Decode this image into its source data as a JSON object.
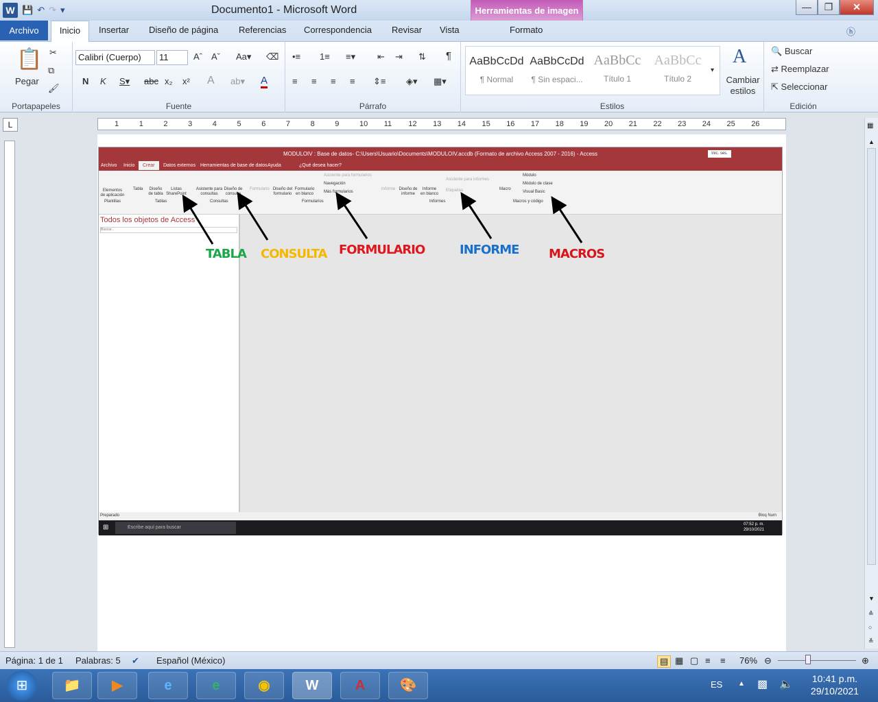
{
  "window": {
    "title": "Documento1 - Microsoft Word",
    "context_tab_header": "Herramientas de imagen",
    "minimize": "—",
    "restore": "❐",
    "close": "✕"
  },
  "tabs": {
    "file": "Archivo",
    "home": "Inicio",
    "insert": "Insertar",
    "layout": "Diseño de página",
    "references": "Referencias",
    "mailings": "Correspondencia",
    "review": "Revisar",
    "view": "Vista",
    "format": "Formato"
  },
  "ribbon": {
    "clipboard": {
      "label": "Portapapeles",
      "paste": "Pegar"
    },
    "font": {
      "label": "Fuente",
      "name": "Calibri (Cuerpo)",
      "size": "11"
    },
    "paragraph": {
      "label": "Párrafo"
    },
    "styles": {
      "label": "Estilos",
      "items": [
        {
          "preview": "AaBbCcDd",
          "name": "¶ Normal"
        },
        {
          "preview": "AaBbCcDd",
          "name": "¶ Sin espaci..."
        },
        {
          "preview": "AaBbCc",
          "name": "Título 1"
        },
        {
          "preview": "AaBbCc",
          "name": "Título 2"
        }
      ],
      "change_styles": "Cambiar estilos"
    },
    "editing": {
      "label": "Edición",
      "find": "Buscar",
      "replace": "Reemplazar",
      "select": "Seleccionar"
    }
  },
  "ruler": {
    "corner": "L",
    "ticks": [
      "1",
      "1",
      "2",
      "3",
      "4",
      "5",
      "6",
      "7",
      "8",
      "9",
      "10",
      "11",
      "12",
      "13",
      "14",
      "15",
      "16",
      "17",
      "18",
      "19",
      "20",
      "21",
      "22",
      "23",
      "24",
      "25",
      "26"
    ]
  },
  "embedded": {
    "title": "MODULOIV : Base de datos- C:\\Users\\Usuario\\Documents\\MODULOIV.accdb (Formato de archivo Access 2007 - 2016) - Access",
    "signin": "Inic. ses.",
    "tabs": [
      "Archivo",
      "Inicio",
      "Crear",
      "Datos externos",
      "Herramientas de base de datos",
      "Ayuda",
      "¿Qué desea hacer?"
    ],
    "groups": [
      "Plantillas",
      "Tablas",
      "Consultas",
      "Formularios",
      "Informes",
      "Macros y código"
    ],
    "buttons": [
      "Elementos de aplicación",
      "Tabla",
      "Diseño de tabla",
      "Listas SharePoint",
      "Asistente para consultas",
      "Diseño de consulta",
      "Formulario",
      "Diseño del formulario",
      "Formulario en blanco",
      "Asistente para formularios",
      "Navegación",
      "Más formularios",
      "Informe",
      "Diseño de informe",
      "Informe en blanco",
      "Asistente para informes",
      "Etiquetas",
      "Macro",
      "Módulo",
      "Módulo de clase",
      "Visual Basic"
    ],
    "nav_header": "Todos los objetos de Access",
    "search_placeholder": "Buscar...",
    "status_left": "Preparado",
    "status_right": "Bloq Num",
    "task_search": "Escribe aquí para buscar",
    "task_time": "07:52 p. m.",
    "task_date": "29/10/2021"
  },
  "annotations": [
    {
      "text": "TABLA",
      "color": "#1aa84a"
    },
    {
      "text": "CONSULTA",
      "color": "#f5b800"
    },
    {
      "text": "FORMULARIO",
      "color": "#e0161e"
    },
    {
      "text": "INFORME",
      "color": "#1a6fc9"
    },
    {
      "text": "MACROS",
      "color": "#d8141c"
    }
  ],
  "statusbar": {
    "page": "Página: 1 de 1",
    "words": "Palabras: 5",
    "language": "Español (México)",
    "zoom": "76%"
  },
  "taskbar": {
    "lang": "ES",
    "time": "10:41 p.m.",
    "date": "29/10/2021"
  }
}
